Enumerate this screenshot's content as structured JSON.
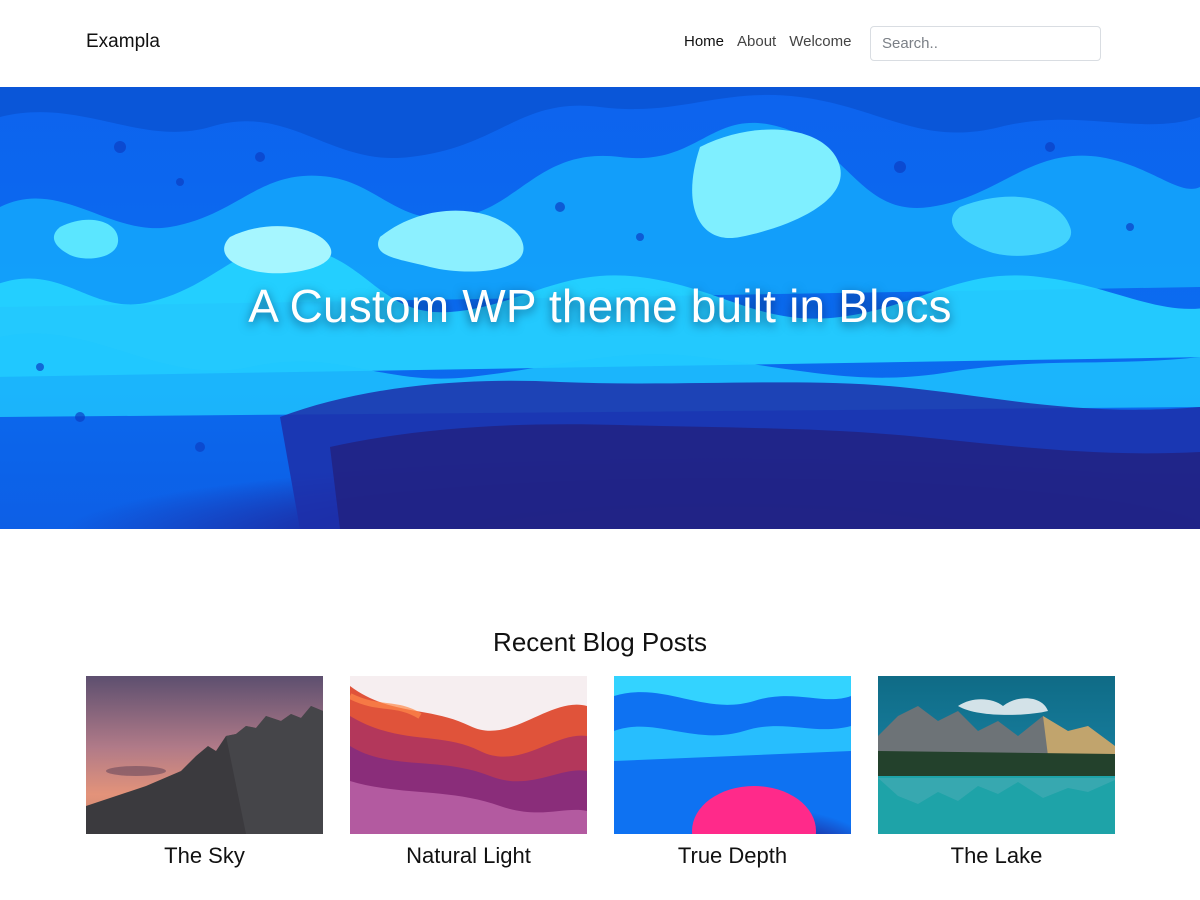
{
  "header": {
    "brand": "Exampla",
    "nav": [
      {
        "label": "Home",
        "active": true
      },
      {
        "label": "About",
        "active": false
      },
      {
        "label": "Welcome",
        "active": false
      }
    ],
    "search": {
      "placeholder": "Search..",
      "value": ""
    }
  },
  "hero": {
    "title": "A Custom WP theme built in Blocs"
  },
  "blog": {
    "section_title": "Recent Blog Posts",
    "posts": [
      {
        "title": "The Sky"
      },
      {
        "title": "Natural Light"
      },
      {
        "title": "True Depth"
      },
      {
        "title": "The Lake"
      }
    ]
  },
  "colors": {
    "hero_cyan": "#1fc8ff",
    "hero_blue": "#0a5be8",
    "hero_deep": "#1a2a9e",
    "text": "#111111",
    "nav_text": "#444444",
    "search_border": "#d9dde2"
  }
}
